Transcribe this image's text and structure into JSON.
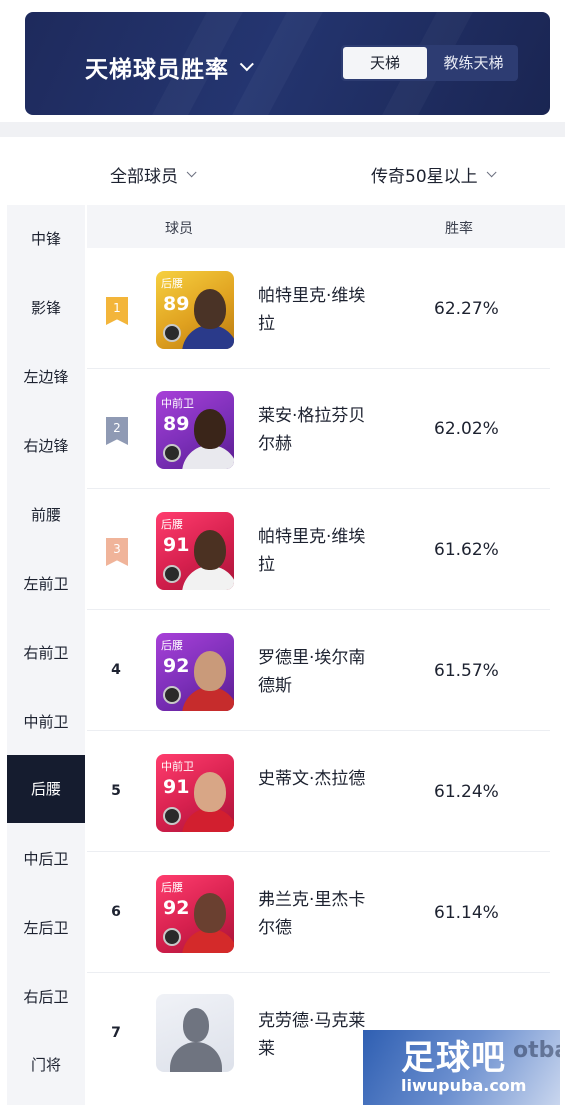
{
  "header": {
    "title": "天梯球员胜率",
    "toggle": [
      {
        "label": "天梯",
        "active": true
      },
      {
        "label": "教练天梯",
        "active": false
      }
    ]
  },
  "filters": {
    "player_filter": "全部球员",
    "tier_filter": "传奇50星以上"
  },
  "sidebar": {
    "items": [
      {
        "label": "中锋"
      },
      {
        "label": "影锋"
      },
      {
        "label": "左边锋"
      },
      {
        "label": "右边锋"
      },
      {
        "label": "前腰"
      },
      {
        "label": "左前卫"
      },
      {
        "label": "右前卫"
      },
      {
        "label": "中前卫"
      },
      {
        "label": "后腰",
        "active": true
      },
      {
        "label": "中后卫"
      },
      {
        "label": "左后卫"
      },
      {
        "label": "右后卫"
      },
      {
        "label": "门将"
      }
    ]
  },
  "table": {
    "columns": {
      "player": "球员",
      "win_rate": "胜率"
    },
    "rows": [
      {
        "rank": "1",
        "badge": "gold",
        "card_color": "gold",
        "position": "后腰",
        "rating": "89",
        "name_line1": "帕特里克·维埃",
        "name_line2": "拉",
        "win_rate": "62.27%"
      },
      {
        "rank": "2",
        "badge": "silver",
        "card_color": "purple",
        "position": "中前卫",
        "rating": "89",
        "name_line1": "莱安·格拉芬贝",
        "name_line2": "尔赫",
        "win_rate": "62.02%"
      },
      {
        "rank": "3",
        "badge": "bronze",
        "card_color": "red",
        "position": "后腰",
        "rating": "91",
        "name_line1": "帕特里克·维埃",
        "name_line2": "拉",
        "win_rate": "61.62%"
      },
      {
        "rank": "4",
        "badge": "",
        "card_color": "purple",
        "position": "后腰",
        "rating": "92",
        "name_line1": "罗德里·埃尔南",
        "name_line2": "德斯",
        "win_rate": "61.57%"
      },
      {
        "rank": "5",
        "badge": "",
        "card_color": "red",
        "position": "中前卫",
        "rating": "91",
        "name_line1": "史蒂文·杰拉德",
        "name_line2": "",
        "win_rate": "61.24%"
      },
      {
        "rank": "6",
        "badge": "",
        "card_color": "red",
        "position": "后腰",
        "rating": "92",
        "name_line1": "弗兰克·里杰卡",
        "name_line2": "尔德",
        "win_rate": "61.14%"
      },
      {
        "rank": "7",
        "badge": "",
        "card_color": "grey",
        "position": "",
        "rating": "",
        "name_line1": "克劳德·马克莱",
        "name_line2": "莱",
        "win_rate": ""
      }
    ]
  },
  "watermark": {
    "brand": "足球吧",
    "url": "liwupuba.com",
    "bg_text": "otba"
  }
}
